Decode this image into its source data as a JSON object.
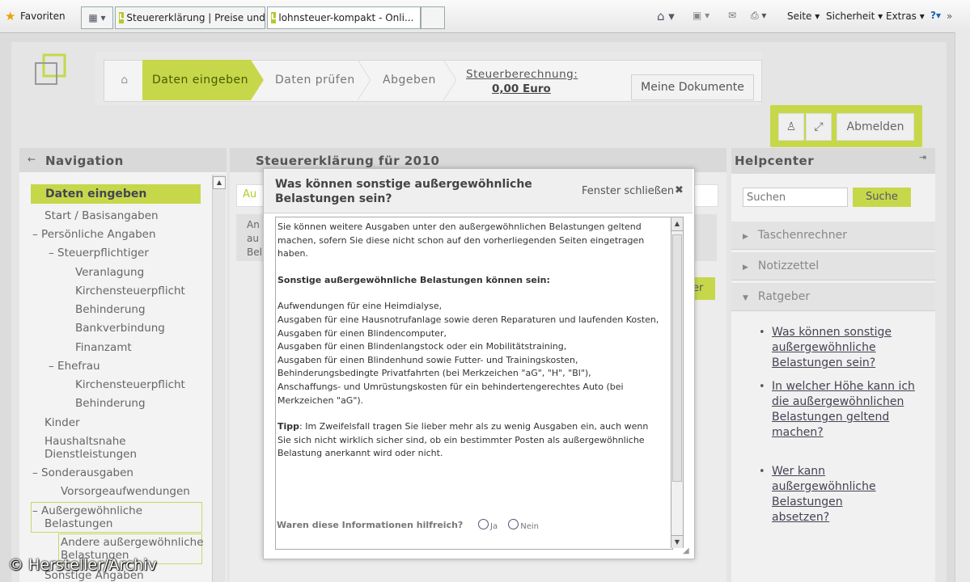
{
  "browser": {
    "favorites": "Favoriten",
    "tabs": [
      {
        "label": "Steuererklärung | Preise und ..."
      },
      {
        "label": "lohnsteuer-kompakt - Onli..."
      }
    ],
    "tab_close": "✕",
    "menu": {
      "page": "Seite ▾",
      "safety": "Sicherheit ▾",
      "extras": "Extras ▾",
      "help": "?▾"
    }
  },
  "app": {
    "steps": [
      "Daten eingeben",
      "Daten prüfen",
      "Abgeben"
    ],
    "tax_calc_label": "Steuerberechnung:",
    "tax_calc_value": "0,00 Euro",
    "documents_button": "Meine Dokumente",
    "logout_button": "Abmelden"
  },
  "navigation": {
    "title": "Navigation",
    "selected": "Daten eingeben",
    "items": [
      "Start / Basisangaben",
      "– Persönliche Angaben",
      "– Steuerpflichtiger",
      "Veranlagung",
      "Kirchensteuerpflicht",
      "Behinderung",
      "Bankverbindung",
      "Finanzamt",
      "– Ehefrau",
      "Kirchensteuerpflicht",
      "Behinderung",
      "Kinder",
      "Haushaltsnahe",
      "Dienstleistungen",
      "– Sonderausgaben",
      "Vorsorgeaufwendungen",
      "– Außergewöhnliche",
      "Belastungen",
      "Andere außergewöhnliche",
      "Belastungen",
      "Sonstige Angaben"
    ]
  },
  "main": {
    "title": "Steuererklärung für 2010",
    "tab_fragment": "Au",
    "text_fragment": [
      "An",
      "au",
      "Bel"
    ],
    "button_fragment": "er"
  },
  "modal": {
    "title_line1": "Was können sonstige außergewöhnliche",
    "title_line2": "Belastungen sein?",
    "close_label": "Fenster schließen",
    "close_icon": "✖",
    "intro": "Sie können weitere Ausgaben unter den außergewöhnlichen Belastungen geltend machen, sofern Sie diese nicht schon auf den vorherliegenden Seiten eingetragen haben.",
    "heading": "Sonstige außergewöhnliche Belastungen können sein:",
    "list": [
      "Aufwendungen für eine Heimdialyse,",
      "Ausgaben für eine Hausnotrufanlage sowie deren Reparaturen und laufenden Kosten,",
      "Ausgaben für einen Blindencomputer,",
      "Ausgaben für einen Blindenlangstock oder ein Mobilitätstraining,",
      "Ausgaben für einen Blindenhund sowie Futter- und Trainingskosten,",
      "Behinderungsbedingte Privatfahrten (bei Merkzeichen \"aG\", \"H\", \"Bl\"),",
      "Anschaffungs- und Umrüstungskosten für ein behindertengerechtes Auto (bei Merkzeichen \"aG\")."
    ],
    "tip_label": "Tipp",
    "tip_text": ": Im Zweifelsfall tragen Sie lieber mehr als zu wenig Ausgaben ein, auch wenn Sie sich nicht wirklich sicher sind, ob ein bestimmter Posten als außergewöhnliche Belastung anerkannt wird oder nicht.",
    "feedback_question": "Waren diese Informationen hilfreich?",
    "yes": "Ja",
    "no": "Nein"
  },
  "help": {
    "title": "Helpcenter",
    "search_placeholder": "Suchen",
    "search_button": "Suche",
    "sections": [
      "Taschenrechner",
      "Notizzettel",
      "Ratgeber"
    ],
    "links": [
      "Was können sonstige außergewöhnliche Belastungen sein?",
      "In welcher Höhe kann ich die außergewöhnlichen Belastungen geltend machen?",
      "Wer kann außergewöhnliche Belastungen absetzen?"
    ]
  },
  "copyright": "© Hersteller/Archiv",
  "colors": {
    "accent": "#c6d84a",
    "panel": "#f3f3f3",
    "header": "#d9d9d9"
  }
}
